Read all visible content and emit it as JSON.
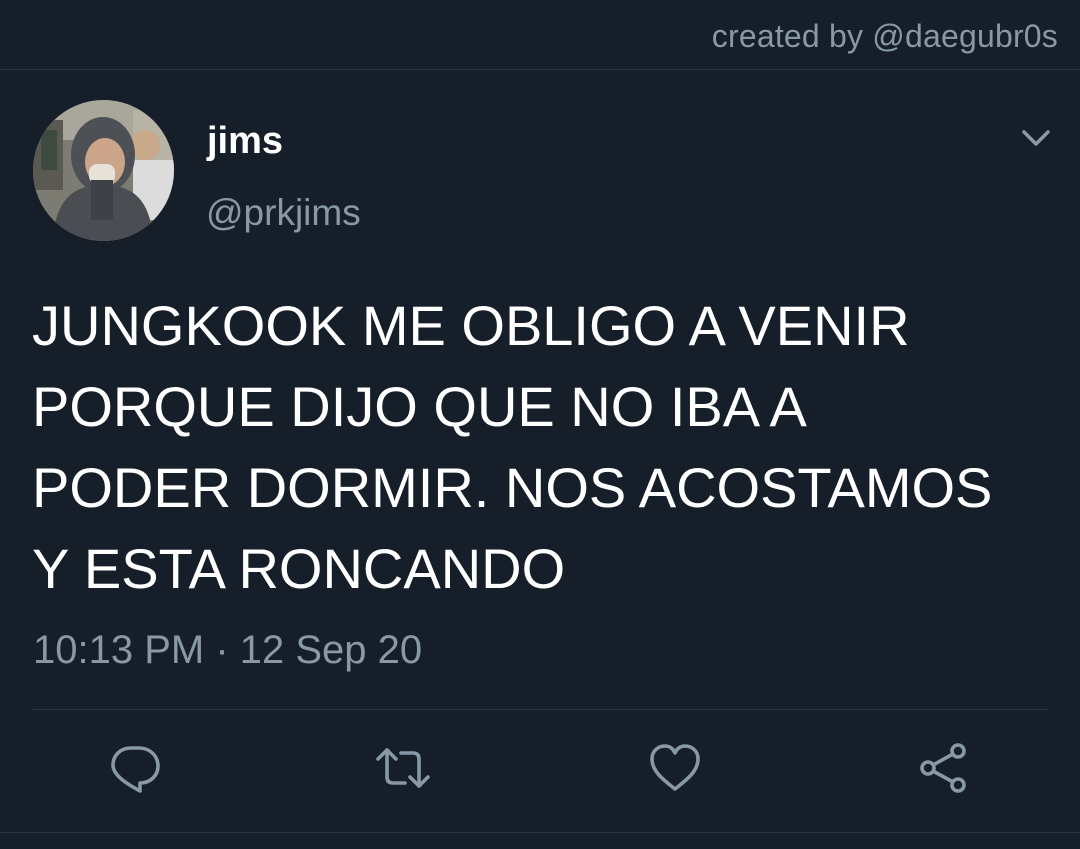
{
  "header": {
    "credit": "created by @daegubr0s"
  },
  "tweet": {
    "name": "jims",
    "handle": "@prkjims",
    "text_lines": [
      "JUNGKOOK ME OBLIGO A VENIR",
      "PORQUE DIJO QUE NO IBA A",
      "PODER DORMIR. NOS ACOSTAMOS",
      "Y ESTA RONCANDO"
    ],
    "timestamp": "10:13 PM · 12 Sep 20"
  },
  "actions": [
    {
      "icon": "reply-icon"
    },
    {
      "icon": "retweet-icon"
    },
    {
      "icon": "like-icon"
    },
    {
      "icon": "share-icon"
    }
  ],
  "colors": {
    "background": "#151e29",
    "primary_text": "#ffffff",
    "secondary_text": "#8898a6",
    "divider": "#2a3644"
  }
}
